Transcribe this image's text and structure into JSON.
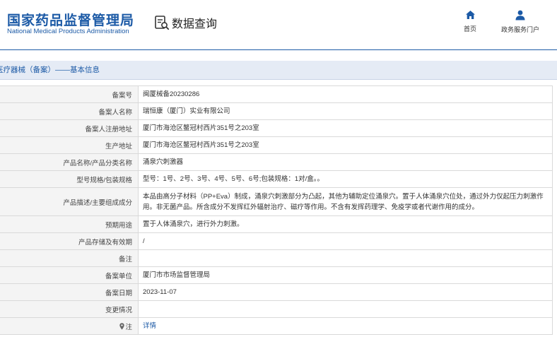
{
  "header": {
    "logo_cn": "国家药品监督管理局",
    "logo_en": "National Medical Products Administration",
    "query_label": "数据查询",
    "nav": {
      "home": "首页",
      "portal": "政务服务门户"
    }
  },
  "section_title": "医疗器械（备案）——基本信息",
  "rows": [
    {
      "label": "备案号",
      "value": "闽厦械备20230286"
    },
    {
      "label": "备案人名称",
      "value": "瑞恒康（厦门）实业有限公司"
    },
    {
      "label": "备案人注册地址",
      "value": "厦门市海沧区鳌冠村西片351号之203室"
    },
    {
      "label": "生产地址",
      "value": "厦门市海沧区鳌冠村西片351号之203室"
    },
    {
      "label": "产品名称/产品分类名称",
      "value": "涌泉穴刺激器"
    },
    {
      "label": "型号规格/包装规格",
      "value": "型号：1号、2号、3号、4号、5号、6号;包装规格：1对/盒。。"
    },
    {
      "label": "产品描述/主要组成成分",
      "value": "本品由高分子材料（PP+Eva）制成，涌泉穴刺激部分为凸起，其他为辅助定位涌泉穴。置于人体涌泉穴位处，通过外力仅起压力刺激作用。非无菌产品。所含成分不发挥红外辐射治疗、磁疗等作用。不含有发挥药理学、免疫学或者代谢作用的成分。"
    },
    {
      "label": "预期用途",
      "value": "置于人体涌泉穴，进行外力刺激。"
    },
    {
      "label": "产品存储及有效期",
      "value": "/"
    },
    {
      "label": "备注",
      "value": ""
    },
    {
      "label": "备案单位",
      "value": "厦门市市场监督管理局"
    },
    {
      "label": "备案日期",
      "value": "2023-11-07"
    },
    {
      "label": "变更情况",
      "value": ""
    },
    {
      "label": "注",
      "value": "详情"
    }
  ],
  "colors": {
    "brand": "#1c5aa6",
    "section_bg": "#e5ebf5",
    "label_bg": "#f4f4f4"
  }
}
